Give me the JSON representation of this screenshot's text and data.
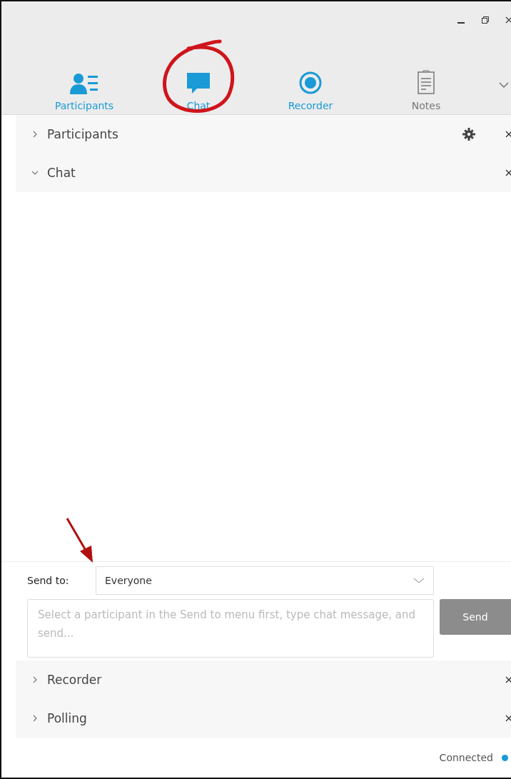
{
  "tabs": [
    {
      "label": "Participants",
      "kind": "participants",
      "on": true
    },
    {
      "label": "Chat",
      "kind": "chat",
      "on": true
    },
    {
      "label": "Recorder",
      "kind": "recorder",
      "on": true
    },
    {
      "label": "Notes",
      "kind": "notes",
      "on": false
    }
  ],
  "panels_top": [
    {
      "title": "Participants",
      "expanded": false,
      "settings": true
    },
    {
      "title": "Chat",
      "expanded": true,
      "settings": false
    }
  ],
  "chat": {
    "send_to_label": "Send to:",
    "send_to_value": "Everyone",
    "message_placeholder": "Select a participant in the Send to menu first, type chat message, and send...",
    "send_button": "Send"
  },
  "panels_bottom": [
    {
      "title": "Recorder",
      "expanded": false,
      "settings": false
    },
    {
      "title": "Polling",
      "expanded": false,
      "settings": false
    }
  ],
  "status": {
    "text": "Connected",
    "connected": true
  }
}
